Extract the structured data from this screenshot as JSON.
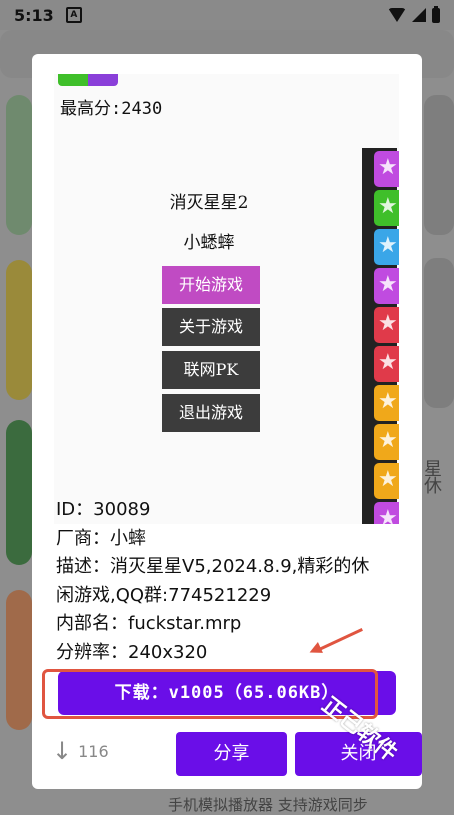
{
  "status_bar": {
    "time": "5:13",
    "app_icon_letter": "A",
    "icons": [
      "wifi-icon",
      "signal-icon",
      "battery-icon"
    ]
  },
  "background_list": {
    "peek_text_1": "星",
    "peek_text_2": "休",
    "bottom_text": "手机模拟播放器 支持游戏同步"
  },
  "dialog": {
    "screenshot": {
      "best_score": "最高分:2430",
      "game_title": "消灭星星2",
      "author": "小蟋蟀",
      "menu": [
        "开始游戏",
        "关于游戏",
        "联网PK",
        "退出游戏"
      ],
      "star_colors": [
        "#c04be0",
        "#3fbf2a",
        "#3aa6e8",
        "#c04be0",
        "#e03a4a",
        "#e03a4a",
        "#f0a81a",
        "#f0a81a",
        "#f0a81a",
        "#c04be0"
      ]
    },
    "info": {
      "id": "ID：30089",
      "vendor": "厂商：小蟀",
      "desc_line1": "描述：消灭星星V5,2024.8.9,精彩的休",
      "desc_line2": "闲游戏,QQ群:774521229",
      "internal_name": "内部名：fuckstar.mrp",
      "resolution": "分辨率：240x320"
    },
    "download_label": "下载：v1005（65.06KB）",
    "download_count": "116",
    "share_label": "分享",
    "close_label": "关闭",
    "colors": {
      "accent": "#6a0ee8",
      "highlight": "#e05540"
    }
  },
  "watermark": "正己软件"
}
